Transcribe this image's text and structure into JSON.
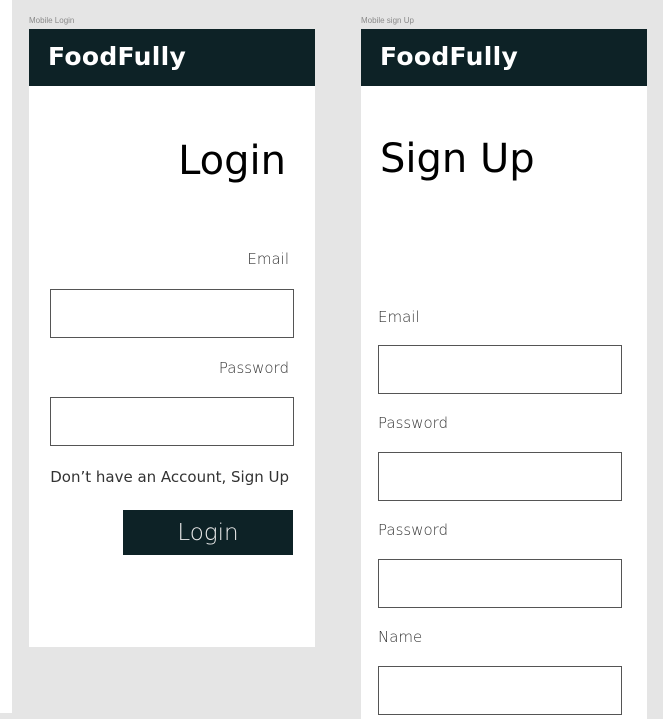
{
  "colors": {
    "brand": "#0d2226",
    "canvas": "#e5e5e5",
    "frame": "#ffffff"
  },
  "login_frame": {
    "label": "Mobile Login",
    "brand": "FoodFully",
    "title": "Login",
    "email_label": "Email",
    "email_value": "",
    "password_label": "Password",
    "password_value": "",
    "signup_link": "Don’t have an Account, Sign Up",
    "login_button": "Login"
  },
  "signup_frame": {
    "label": "Mobile sign Up",
    "brand": "FoodFully",
    "title": "Sign Up",
    "email_label": "Email",
    "email_value": "",
    "password_label": "Password",
    "password_value": "",
    "confirm_password_label": "Password",
    "confirm_password_value": "",
    "name_label": "Name",
    "name_value": ""
  }
}
